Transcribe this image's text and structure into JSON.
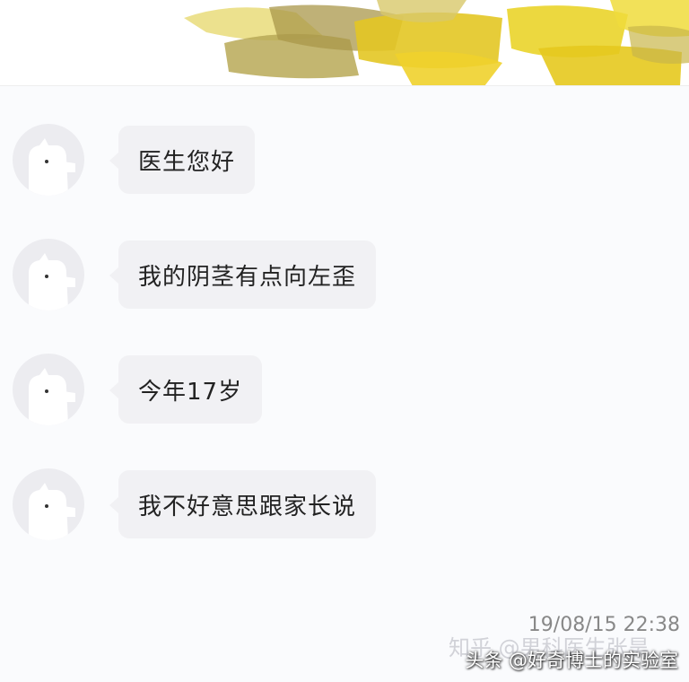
{
  "header": {
    "decoration": "yellow-paint-strokes"
  },
  "colors": {
    "background": "#fafbfd",
    "bubble": "#f1f1f4",
    "avatar": "#ececf0",
    "paint_yellow": "#e8d21a",
    "paint_olive": "#b8a64a"
  },
  "messages": [
    {
      "text": "医生您好"
    },
    {
      "text": "我的阴茎有点向左歪"
    },
    {
      "text": "今年17岁"
    },
    {
      "text": "我不好意思跟家长说"
    }
  ],
  "timestamp": "19/08/15 22:38",
  "watermarks": {
    "zhihu": "知乎 @男科医生张昊",
    "toutiao": "头条 @好奇博士的实验室"
  }
}
